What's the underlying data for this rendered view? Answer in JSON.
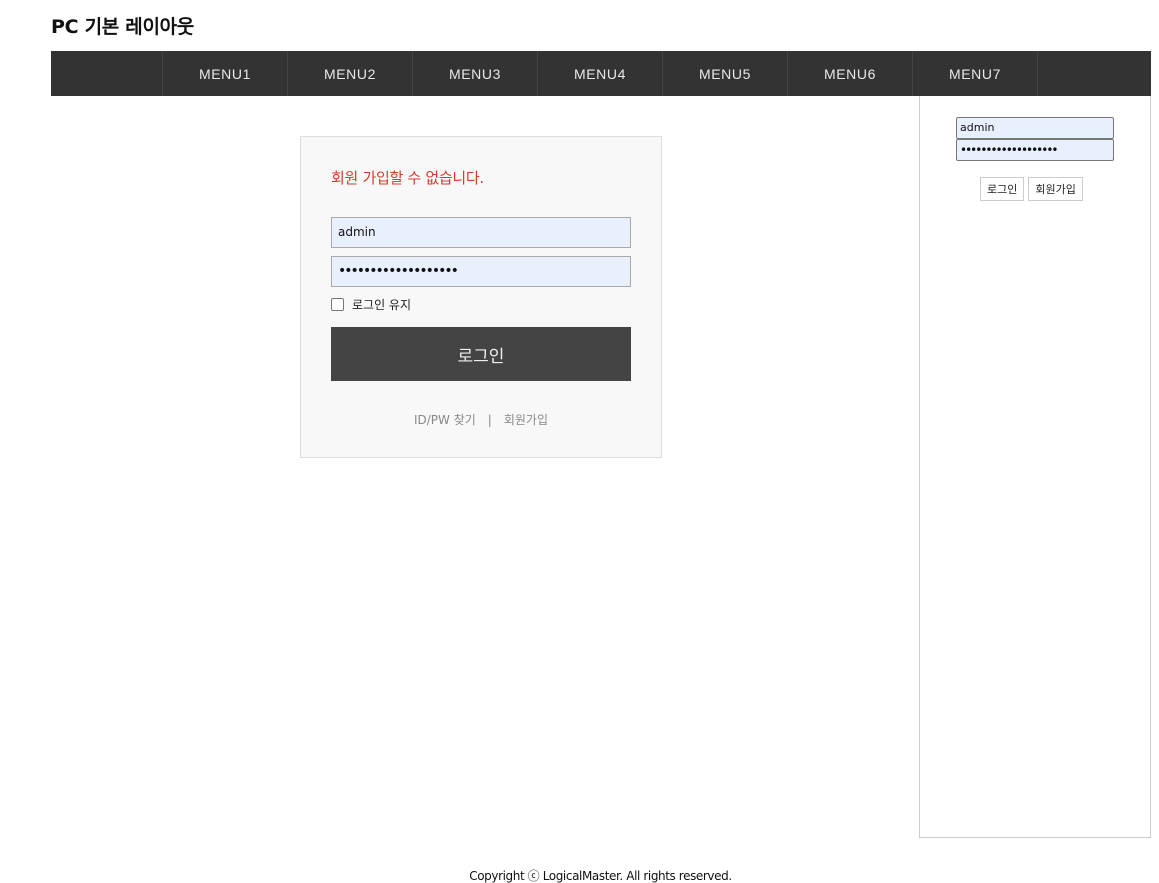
{
  "header": {
    "title_bold": "PC",
    "title_rest": " 기본 레이아웃"
  },
  "nav": {
    "items": [
      "MENU1",
      "MENU2",
      "MENU3",
      "MENU4",
      "MENU5",
      "MENU6",
      "MENU7"
    ]
  },
  "login_box": {
    "message": "회원 가입할 수 없습니다.",
    "id_value": "admin",
    "password_mask": "•••••••••••••••••••",
    "keep_login_label": "로그인 유지",
    "keep_login_checked": false,
    "login_button": "로그인",
    "find_link": "ID/PW 찾기",
    "separator": "|",
    "signup_link": "회원가입"
  },
  "sidebar": {
    "id_value": "admin",
    "password_mask": "•••••••••••••••••••",
    "login_button": "로그인",
    "signup_button": "회원가입"
  },
  "footer": {
    "copyright": "Copyright ⓒ LogicalMaster. All rights reserved."
  },
  "colors": {
    "nav_bg": "#333333",
    "error_text": "#d93a2b",
    "button_bg": "#444444",
    "autofill_bg": "#e8f0fe"
  }
}
